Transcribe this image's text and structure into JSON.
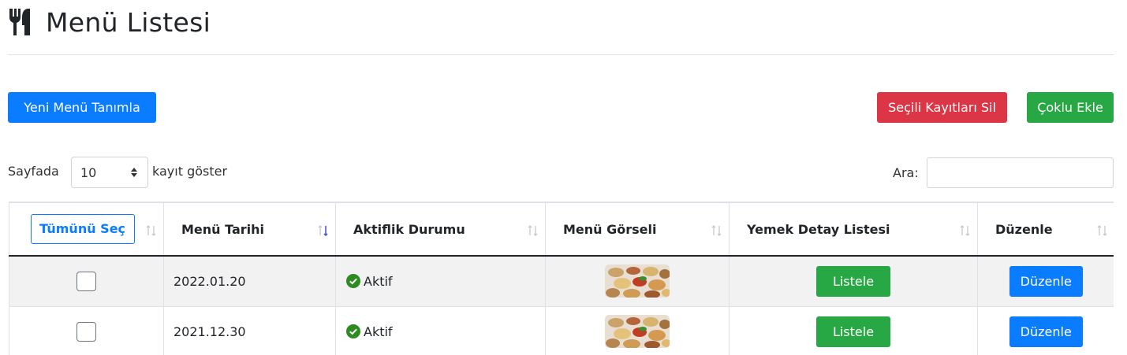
{
  "header": {
    "title": "Menü Listesi",
    "icon": "utensils-icon"
  },
  "toolbar": {
    "new_menu_label": "Yeni Menü Tanımla",
    "delete_selected_label": "Seçili Kayıtları Sil",
    "bulk_add_label": "Çoklu Ekle"
  },
  "length_control": {
    "prefix": "Sayfada",
    "value": "10",
    "suffix": "kayıt göster"
  },
  "search": {
    "label": "Ara:",
    "value": ""
  },
  "table": {
    "select_all_label": "Tümünü Seç",
    "columns": [
      "Menü Tarihi",
      "Aktiflik Durumu",
      "Menü Görseli",
      "Yemek Detay Listesi",
      "Düzenle"
    ],
    "rows": [
      {
        "date": "2022.01.20",
        "status": "Aktif",
        "list_label": "Listele",
        "edit_label": "Düzenle"
      },
      {
        "date": "2021.12.30",
        "status": "Aktif",
        "list_label": "Listele",
        "edit_label": "Düzenle"
      }
    ]
  },
  "colors": {
    "primary": "#0a7cff",
    "danger": "#dc3545",
    "success": "#28a745",
    "status_ok": "#2e8b22"
  }
}
